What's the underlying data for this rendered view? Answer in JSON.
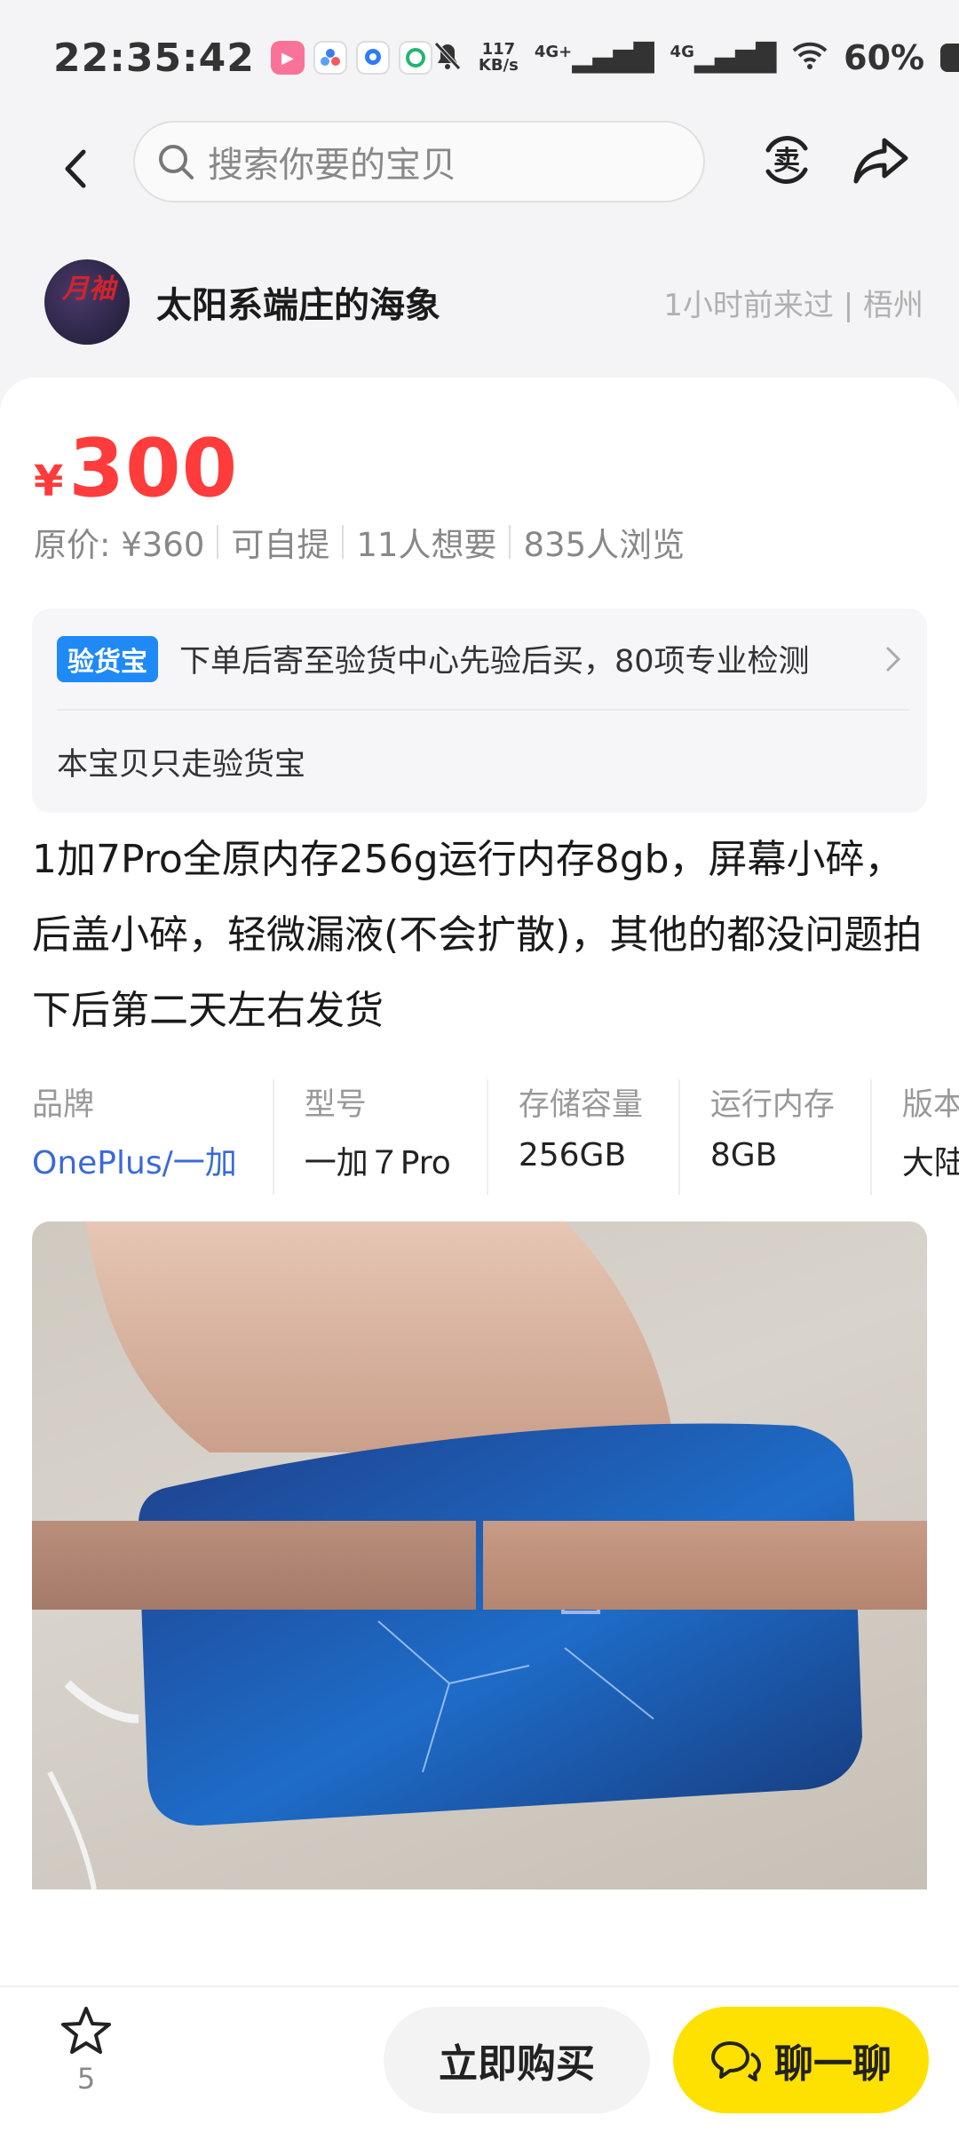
{
  "status_bar": {
    "time": "22:35:42",
    "net_speed_value": "117",
    "net_speed_unit": "KB/s",
    "signal1": "4G+",
    "signal2": "4G",
    "battery_text": "60%",
    "battery_level": 0.6,
    "app_icons": [
      "bilibili-icon",
      "app-icon-blue",
      "map-icon",
      "refresh-app-icon"
    ]
  },
  "nav": {
    "search_placeholder": "搜索你要的宝贝",
    "sell_label": "卖"
  },
  "seller": {
    "name": "太阳系端庄的海象",
    "meta": "1小时前来过 | 梧州",
    "avatar_text": "月袖"
  },
  "price": {
    "symbol": "¥",
    "value": "300"
  },
  "meta": [
    "原价: ¥360",
    "可自提",
    "11人想要",
    "835人浏览"
  ],
  "inspection": {
    "badge": "验货宝",
    "text": "下单后寄至验货中心先验后买，80项专业检测",
    "note": "本宝贝只走验货宝"
  },
  "description": "1加7Pro全原内存256g运行内存8gb，屏幕小碎，后盖小碎，轻微漏液(不会扩散)，其他的都没问题拍下后第二天左右发货",
  "specs": [
    {
      "label": "品牌",
      "value": "OnePlus/一加"
    },
    {
      "label": "型号",
      "value": "一加７Pro"
    },
    {
      "label": "存储容量",
      "value": "256GB"
    },
    {
      "label": "运行内存",
      "value": "8GB"
    },
    {
      "label": "版本",
      "value": "大陆"
    }
  ],
  "bottom": {
    "fav_count": "5",
    "buy_label": "立即购买",
    "chat_label": "聊一聊"
  },
  "colors": {
    "price": "#ff3b3b",
    "accent_yellow": "#ffe100",
    "badge_blue": "#1f8af6",
    "link_blue": "#3a6ad7"
  }
}
